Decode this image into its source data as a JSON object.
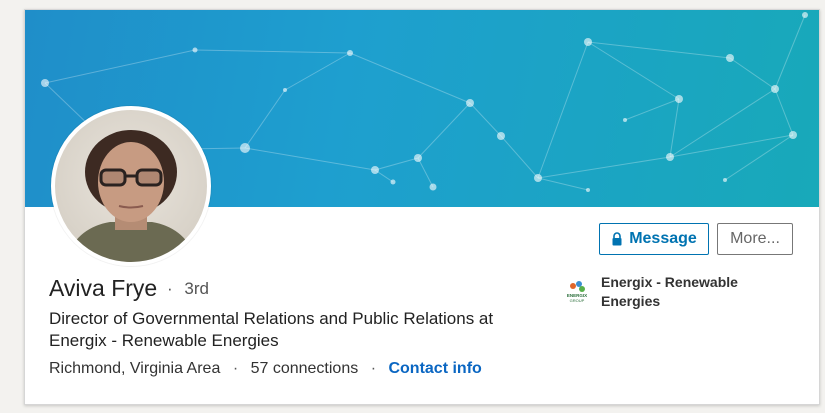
{
  "profile": {
    "name": "Aviva Frye",
    "degree": "3rd",
    "headline": "Director of Governmental Relations and Public Relations at Energix - Renewable Energies",
    "location": "Richmond, Virginia Area",
    "connections": "57 connections",
    "contact_info": "Contact info",
    "separator": "·"
  },
  "actions": {
    "message_label": "Message",
    "more_label": "More..."
  },
  "company": {
    "name": "Energix - Renewable Energies",
    "logo_text": "ENERGIX GROUP"
  },
  "colors": {
    "link_blue": "#0a66c2",
    "button_blue": "#0073b1",
    "banner_start": "#1f8ec9",
    "banner_end": "#18a9b9"
  },
  "icons": {
    "message_icon": "lock-icon"
  }
}
